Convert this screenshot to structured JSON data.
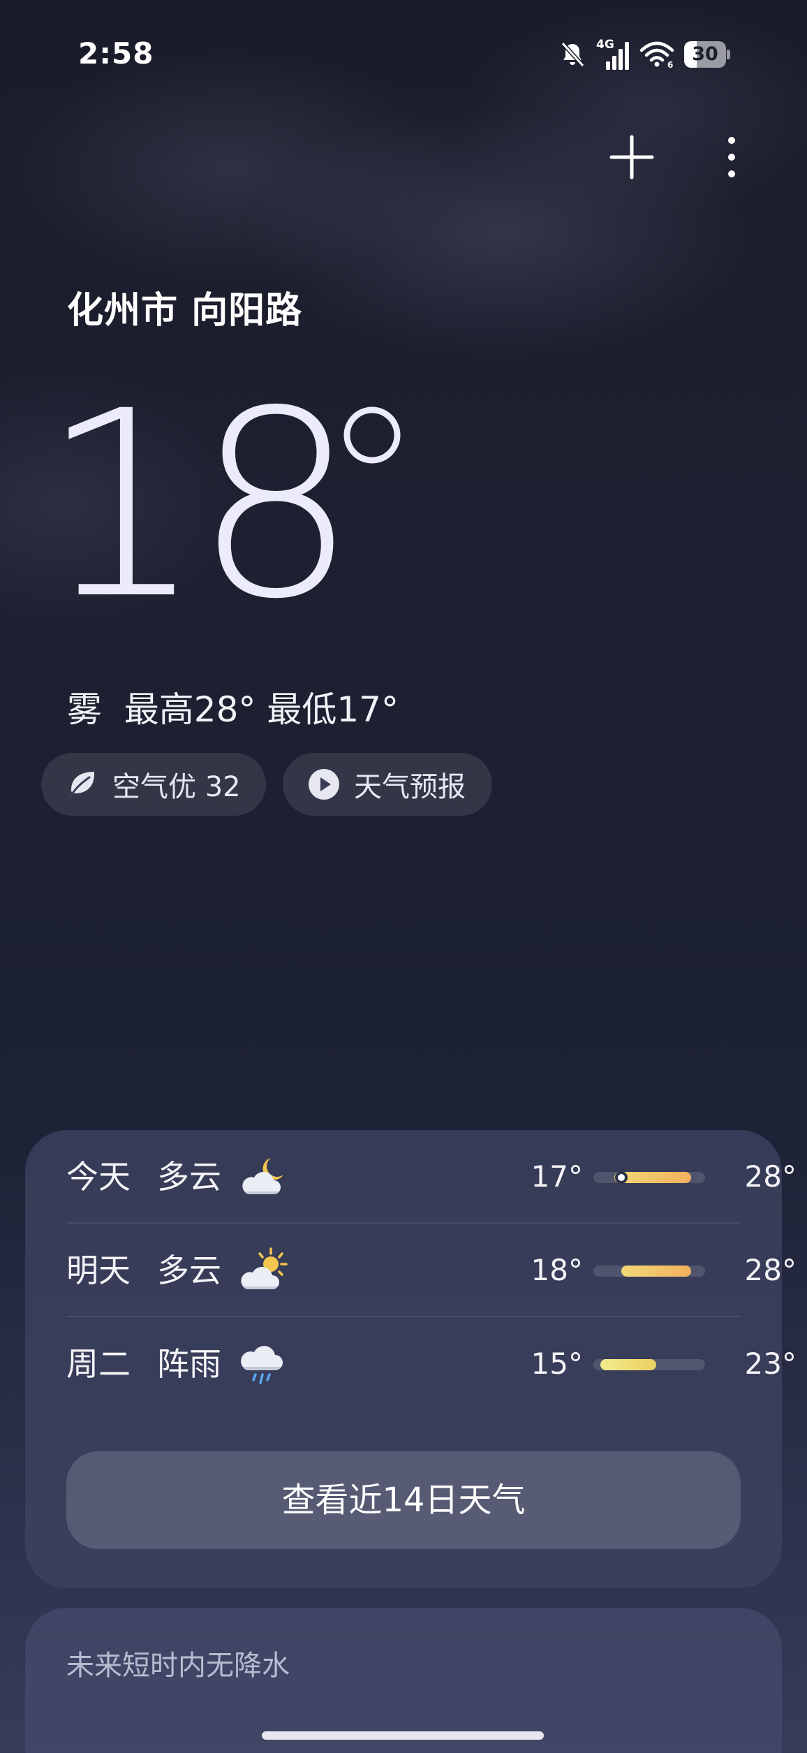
{
  "status_bar": {
    "time": "2:58",
    "network": "4G",
    "battery_level": "30",
    "icons": [
      "bell-off-icon",
      "signal-icon",
      "wifi-icon",
      "battery-icon"
    ]
  },
  "header": {
    "actions": [
      "add-icon",
      "more-icon"
    ]
  },
  "current": {
    "location": "化州市 向阳路",
    "temperature": "18",
    "condition": "雾",
    "high": "最高28°",
    "low": "最低17°"
  },
  "chips": {
    "air_quality": "空气优 32",
    "forecast": "天气预报"
  },
  "daily": [
    {
      "day": "今天",
      "condition": "多云",
      "icon": "partly-cloudy-night-icon",
      "low": "17°",
      "high": "28°",
      "range_low": 17,
      "range_high": 28,
      "current": 18
    },
    {
      "day": "明天",
      "condition": "多云",
      "icon": "partly-cloudy-day-icon",
      "low": "18°",
      "high": "28°",
      "range_low": 18,
      "range_high": 28
    },
    {
      "day": "周二",
      "condition": "阵雨",
      "icon": "rain-icon",
      "low": "15°",
      "high": "23°",
      "range_low": 15,
      "range_high": 23
    }
  ],
  "daily_scale": {
    "min": 14,
    "max": 30
  },
  "more_days_button": "查看近14日天气",
  "precipitation": "未来短时内无降水",
  "colors": {
    "bar_warm_start": "#f1d877",
    "bar_warm_end": "#f2b05e",
    "card_bg": "#3e4360"
  }
}
